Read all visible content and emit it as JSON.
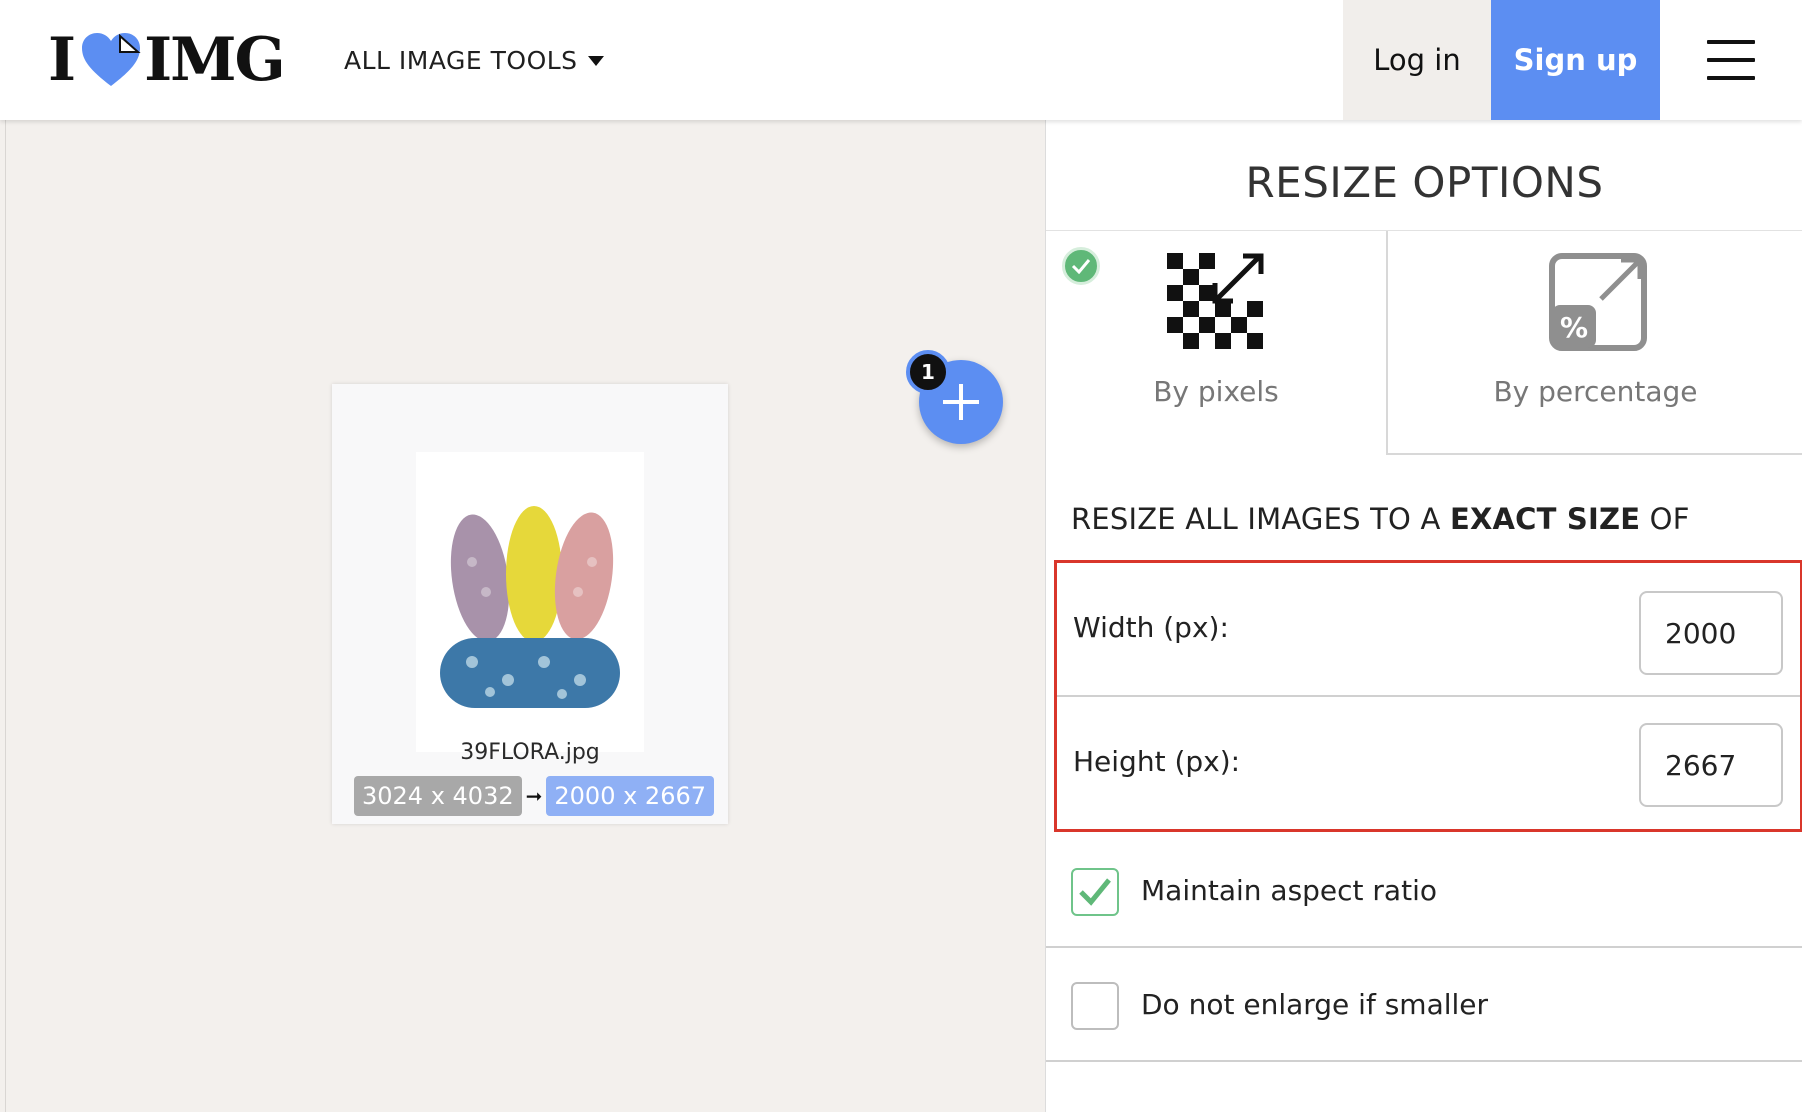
{
  "header": {
    "logo_left": "I",
    "logo_right": "IMG",
    "all_tools_label": "ALL IMAGE TOOLS",
    "login_label": "Log in",
    "signup_label": "Sign up",
    "accent_color": "#5c8ef2"
  },
  "workspace": {
    "file": {
      "name": "39FLORA.jpg",
      "original_size": "3024 x 4032",
      "new_size": "2000 x 2667"
    },
    "file_count": "1"
  },
  "panel": {
    "title": "RESIZE OPTIONS",
    "modes": [
      {
        "label": "By pixels",
        "selected": true,
        "icon": "pixels-resize-icon"
      },
      {
        "label": "By percentage",
        "selected": false,
        "icon": "percent-resize-icon"
      }
    ],
    "exact_prefix": "RESIZE ALL IMAGES TO A ",
    "exact_bold": "EXACT SIZE",
    "exact_suffix": " OF",
    "width_label": "Width (px):",
    "width_value": "2000",
    "height_label": "Height (px):",
    "height_value": "2667",
    "maintain_aspect_label": "Maintain aspect ratio",
    "maintain_aspect_checked": true,
    "no_enlarge_label": "Do not enlarge if smaller",
    "no_enlarge_checked": false,
    "highlight_color": "#d9362b"
  }
}
